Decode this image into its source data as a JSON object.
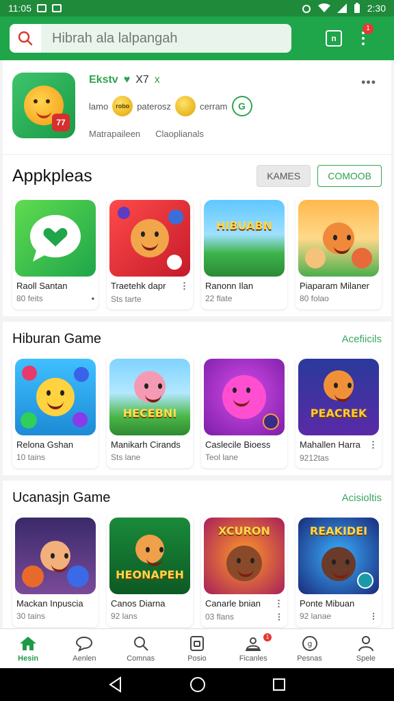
{
  "status_bar": {
    "time": "11:05",
    "right_text": "2:30"
  },
  "search": {
    "placeholder": "Hibrah ala lalpangah"
  },
  "featured": {
    "name": "Ekstv",
    "version": "X7",
    "x_mark": "x",
    "tag1": "lamo",
    "coin_label": "robo",
    "tag2": "paterosz",
    "tag3": "cerram",
    "g_label": "G",
    "sub1": "Matrapaileen",
    "sub2": "Claoplianals",
    "icon_badge": "77"
  },
  "sections": [
    {
      "title": "Appkpleas",
      "chip_grey": "KAMES",
      "chip_green": "COMOOB",
      "items": [
        {
          "name": "Raoll Santan",
          "meta": "80 feits",
          "art": "chat-heart-icon"
        },
        {
          "name": "Traetehk dapr",
          "meta": "Sts tarte",
          "art": "cartoon-dice"
        },
        {
          "name": "Ranonn Ilan",
          "meta": "22 flate",
          "art": "hibuabn-scene",
          "word": "HIBUABN"
        },
        {
          "name": "Piaparam Milaner",
          "meta": "80 folao",
          "art": "cartoon-family"
        }
      ]
    },
    {
      "title": "Hiburan Game",
      "link": "Acefiicils",
      "items": [
        {
          "name": "Relona Gshan",
          "meta": "10 tains",
          "art": "bubbles"
        },
        {
          "name": "Manikarh Cirands",
          "meta": "Sts lane",
          "art": "hecebni",
          "word": "HECEBNI"
        },
        {
          "name": "Caslecile Bioess",
          "meta": "Teol lane",
          "art": "pink-star"
        },
        {
          "name": "Mahallen Harra",
          "meta": "9212tas",
          "art": "peacrek",
          "word": "PEACREK"
        }
      ]
    },
    {
      "title": "Ucanasjn Game",
      "link": "Acisioltis",
      "items": [
        {
          "name": "Mackan Inpuscia",
          "meta": "30 tains",
          "art": "elves"
        },
        {
          "name": "Canos Diarna",
          "meta": "92 lans",
          "art": "heonapeh",
          "word": "HEONAPEH"
        },
        {
          "name": "Canarle bnian",
          "meta": "03 flans",
          "art": "xcuron",
          "word": "XCURON"
        },
        {
          "name": "Ponte Mibuan",
          "meta": "92 lanae",
          "art": "reakidei",
          "word": "REAKIDEI"
        }
      ]
    }
  ],
  "bottom_nav": [
    {
      "label": "Hesin",
      "icon": "home-icon",
      "active": true
    },
    {
      "label": "Aenlen",
      "icon": "chat-icon"
    },
    {
      "label": "Comnas",
      "icon": "search-icon"
    },
    {
      "label": "Posio",
      "icon": "lock-icon"
    },
    {
      "label": "Ficanles",
      "icon": "person-card-icon",
      "badge": "1"
    },
    {
      "label": "Pesnas",
      "icon": "g-coin-icon"
    },
    {
      "label": "Spele",
      "icon": "profile-icon"
    }
  ],
  "colors": {
    "brand": "#1fa54a",
    "status_bar": "#1e8a3a",
    "accent_text": "#3aa760"
  }
}
